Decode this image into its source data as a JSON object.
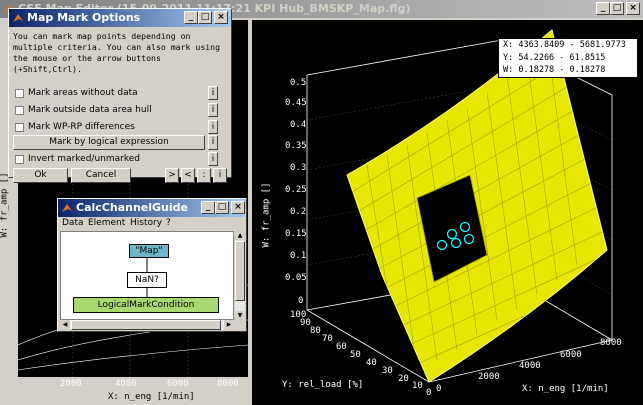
{
  "main_window": {
    "title": "CSE Map Editor (15-09-2011 11:17:21 KPI Hub_BMSKP_Map.flg)"
  },
  "readout": {
    "line_x": "X: 4363.8409 - 5681.9773",
    "line_y": "Y:  54.2266 - 61.8515",
    "line_w": "W:  0.18278 - 0.18278"
  },
  "left_plot": {
    "xlabel": "X: n_eng [1/min]",
    "ylabel": "W: fr_amp []",
    "xticks": [
      "2000",
      "4000",
      "6000",
      "8000"
    ]
  },
  "right_plot": {
    "zlabel": "W: fr_amp []",
    "xlabel": "X: n_eng [1/min]",
    "ylabel": "Y: rel_load [%]",
    "zticks": [
      "0.5",
      "0.45",
      "0.4",
      "0.35",
      "0.3",
      "0.25",
      "0.2",
      "0.15",
      "0.1",
      "0.05",
      "0"
    ],
    "xticks": [
      "0",
      "2000",
      "4000",
      "6000",
      "8000"
    ],
    "yticks": [
      "0",
      "10",
      "20",
      "30",
      "40",
      "50",
      "60",
      "70",
      "80",
      "90",
      "100"
    ],
    "surface_color": "#ffff40",
    "marker_color": "#00ffff"
  },
  "map_mark": {
    "title": "Map Mark Options",
    "description": "You can mark map points depending on multiple criteria. You can also mark using the mouse or the arrow buttons (+Shift,Ctrl).",
    "options": [
      {
        "label": "Mark areas without data",
        "checked": false
      },
      {
        "label": "Mark outside data area hull",
        "checked": false
      },
      {
        "label": "Mark WP-RP differences",
        "checked": false
      }
    ],
    "logical_button": "Mark by logical expression",
    "invert_label": "Invert marked/unmarked",
    "ok": "Ok",
    "cancel": "Cancel",
    "arrow_right": ">",
    "arrow_left": "<",
    "arrow_dots": ":",
    "arrow_info": "i"
  },
  "calc_guide": {
    "title": "CalcChannelGuide",
    "menu": [
      "Data",
      "Element",
      "History",
      "?"
    ],
    "node_map": "\"Map\"",
    "node_nan": "NaN?",
    "node_logical": "LogicalMarkCondition"
  }
}
